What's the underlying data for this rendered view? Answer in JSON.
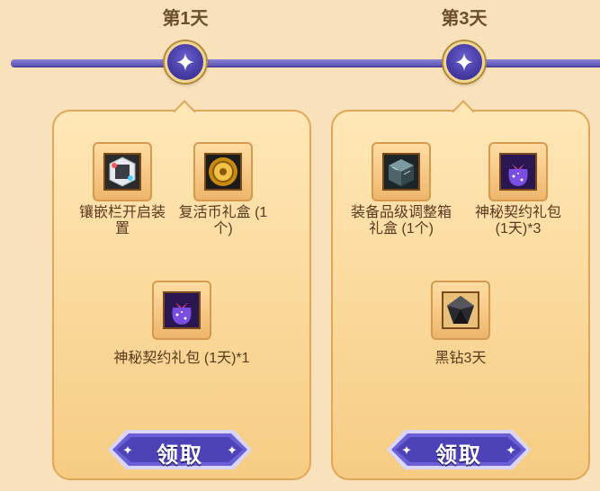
{
  "days": [
    {
      "label": "第1天",
      "items": [
        {
          "name": "镶嵌栏开启装置",
          "icon": "socket-device-icon"
        },
        {
          "name": "复活币礼盒 (1个)",
          "icon": "coin-box-icon"
        },
        {
          "name": "神秘契约礼包 (1天)*1",
          "icon": "purple-bag-icon"
        }
      ],
      "claim_label": "领取"
    },
    {
      "label": "第3天",
      "items": [
        {
          "name": "装备品级调整箱礼盒 (1个)",
          "icon": "stone-cube-icon"
        },
        {
          "name": "神秘契约礼包 (1天)*3",
          "icon": "purple-bag-icon"
        },
        {
          "name": "黑钻3天",
          "icon": "black-diamond-icon"
        }
      ],
      "claim_label": "领取"
    }
  ],
  "colors": {
    "background": "#f9e1bb",
    "track": "#6a5fcf",
    "card_border": "#e0a65a",
    "button": "#5b4ec4"
  }
}
